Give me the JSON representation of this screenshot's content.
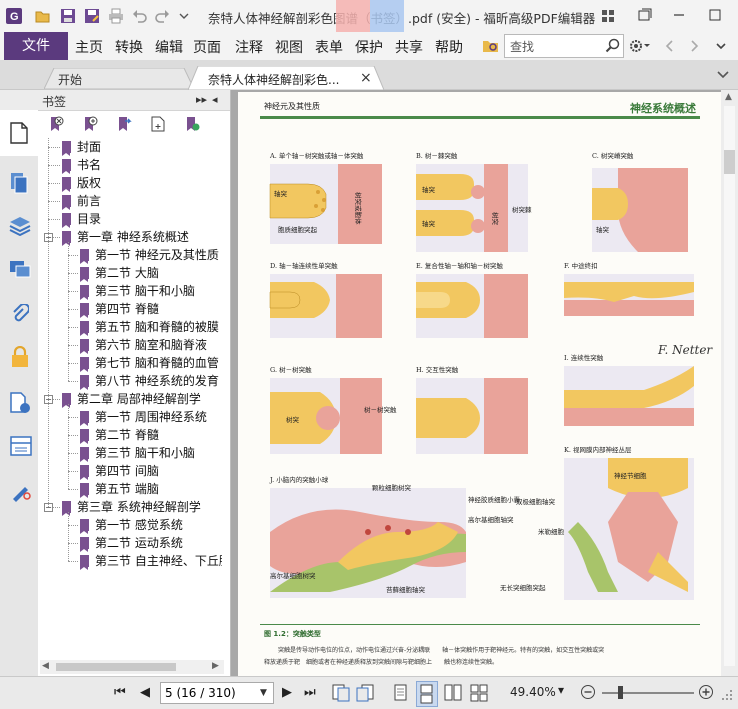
{
  "window": {
    "title": "奈特人体神经解剖彩色图谱（书签）.pdf (安全) - 福昕高级PDF编辑器",
    "minimize_icon": "minimize-icon",
    "maximize_icon": "maximize-icon",
    "close_icon": "close-icon"
  },
  "menu": {
    "file": "文件",
    "items": [
      "主页",
      "转换",
      "编辑",
      "页面",
      "注释",
      "视图",
      "表单",
      "保护",
      "共享",
      "帮助"
    ],
    "search_placeholder": "查找"
  },
  "tabs": [
    {
      "label": "开始"
    },
    {
      "label": "奈特人体神经解剖彩色...",
      "close": "×"
    }
  ],
  "sidebar": {
    "title": "书签",
    "bookmarks": [
      {
        "label": "封面",
        "level": 0
      },
      {
        "label": "书名",
        "level": 0
      },
      {
        "label": "版权",
        "level": 0
      },
      {
        "label": "前言",
        "level": 0
      },
      {
        "label": "目录",
        "level": 0
      },
      {
        "label": "第一章 神经系统概述",
        "level": 0,
        "expander": "−"
      },
      {
        "label": "第一节 神经元及其性质",
        "level": 1
      },
      {
        "label": "第二节 大脑",
        "level": 1
      },
      {
        "label": "第三节 脑干和小脑",
        "level": 1
      },
      {
        "label": "第四节 脊髓",
        "level": 1
      },
      {
        "label": "第五节 脑和脊髓的被膜",
        "level": 1
      },
      {
        "label": "第六节 脑室和脑脊液",
        "level": 1
      },
      {
        "label": "第七节 脑和脊髓的血管",
        "level": 1
      },
      {
        "label": "第八节 神经系统的发育",
        "level": 1
      },
      {
        "label": "第二章 局部神经解剖学",
        "level": 0,
        "expander": "−"
      },
      {
        "label": "第一节 周围神经系统",
        "level": 1
      },
      {
        "label": "第二节 脊髓",
        "level": 1
      },
      {
        "label": "第三节 脑干和小脑",
        "level": 1
      },
      {
        "label": "第四节 间脑",
        "level": 1
      },
      {
        "label": "第五节 端脑",
        "level": 1
      },
      {
        "label": "第三章 系统神经解剖学",
        "level": 0,
        "expander": "−"
      },
      {
        "label": "第一节 感觉系统",
        "level": 1
      },
      {
        "label": "第二节 运动系统",
        "level": 1
      },
      {
        "label": "第三节 自主神经、下丘脑",
        "level": 1
      }
    ]
  },
  "page": {
    "header_left": "神经元及其性质",
    "header_right": "神经系统概述",
    "panels": {
      "A": "A. 单个轴－树突触或轴－体突触",
      "B": "B. 树－棘突触",
      "C": "C. 树突嵴突触",
      "D": "D. 轴－轴连续性单突触",
      "E": "E. 复合性轴－轴和轴－树突触",
      "F": "F. 中途终扣",
      "G": "G. 树－树突触",
      "H": "H. 交互性突触",
      "I": "I. 连续性突触",
      "J": "J. 小脑内的突触小球",
      "K": "K. 视网膜内部神经丛层"
    },
    "labels": {
      "axon": "轴突",
      "soma_or_dendrite": "树突或胞体",
      "postsyn": "胞质细胞突起",
      "dendrite": "树突",
      "spine": "树突棘",
      "dendrite2": "树突",
      "dd_syn": "树－树突触",
      "granule": "颗粒细胞树突",
      "glial": "神经胶质细胞小囊",
      "golgi": "高尔基细胞轴突",
      "golgi_dend": "高尔基细胞树突",
      "mossy": "苔藓细胞轴突",
      "ganglion": "神经节细胞",
      "bipolar": "双极细胞轴突",
      "amacrine": "米勒细胞",
      "amacrine2": "无长突细胞突起"
    },
    "caption_title": "图 1.2：突触类型",
    "caption_text": "突触是传导动作电位的位点，动作电位通过兴奋-分泌耦联　　轴－体突触作用于靶神经元。特有的突触，如交互性突触或突",
    "caption_text2": "释放递质于靶　细胞或者在神经递质释放到突触间隙与靶细胞上　　触也称连续性突触。"
  },
  "status": {
    "page_display": "5 (16 / 310)",
    "zoom": "49.40%"
  }
}
